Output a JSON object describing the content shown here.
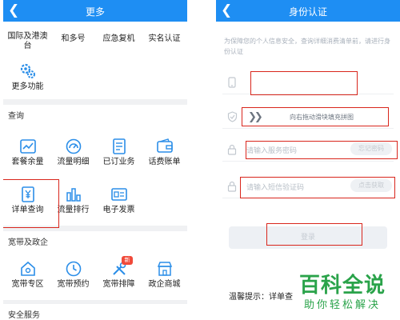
{
  "left_screen": {
    "title": "更多",
    "top_row": [
      "国际及港澳台",
      "和多号",
      "应急复机",
      "实名认证"
    ],
    "more_functions": "更多功能",
    "section_query": "查询",
    "query_row1": [
      "套餐余量",
      "流量明细",
      "已订业务",
      "话费账单"
    ],
    "query_row2": [
      "详单查询",
      "流量排行",
      "电子发票"
    ],
    "section_broadband": "宽带及政企",
    "broadband_row": [
      "宽带专区",
      "宽带预约",
      "宽带排障",
      "政企商城"
    ],
    "badge_new": "新",
    "section_security": "安全服务"
  },
  "right_screen": {
    "title": "身份认证",
    "tip": "为保障您的个人信息安全，查询详细消费清单前，请进行身份认证",
    "slider_text": "向右拖动滑块填充拼图",
    "password_placeholder": "请输入服务密码",
    "forgot_password": "忘记密码",
    "sms_placeholder": "请输入短信验证码",
    "get_code": "点击获取",
    "login_button": "登录",
    "warm_tip": "温馨提示：详单查"
  },
  "watermark": {
    "main": "百科全说",
    "sub": "助你轻松解决"
  },
  "colors": {
    "header_blue": "#1e8ef3",
    "icon_blue": "#2b8ee8",
    "highlight_red": "#d9261c",
    "watermark_green": "#2aa34a",
    "badge_red": "#f04a3a"
  }
}
